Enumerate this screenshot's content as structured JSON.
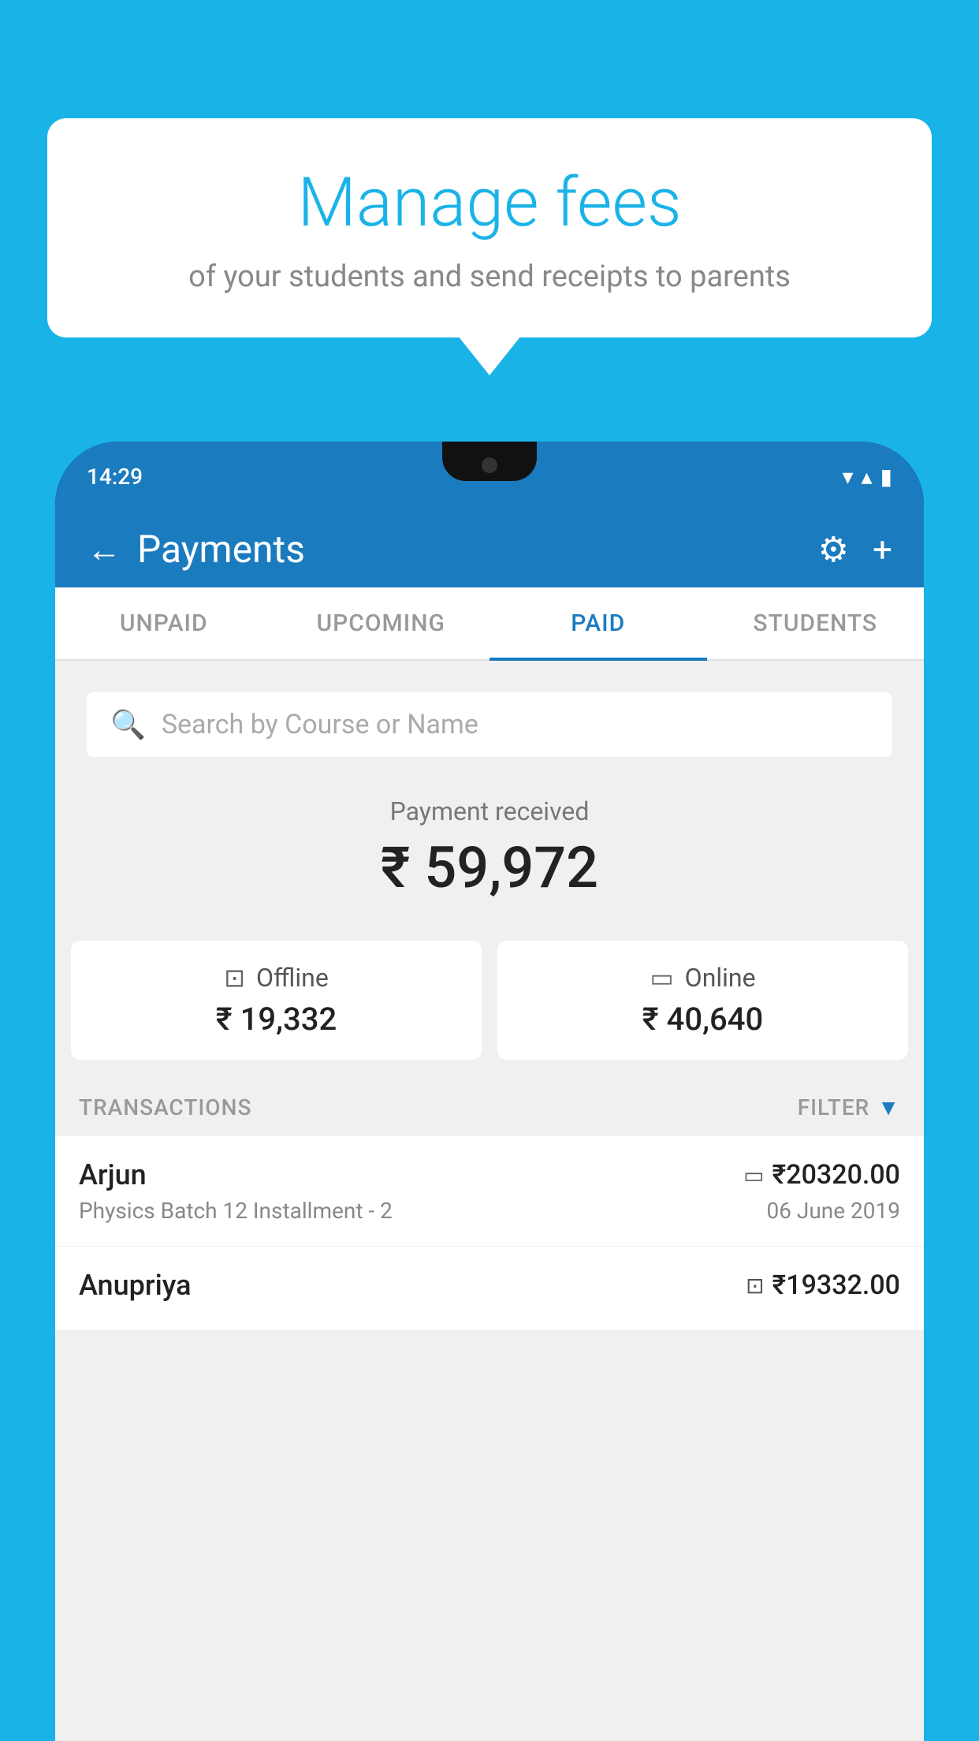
{
  "background": {
    "color": "#1ab3e8"
  },
  "speech_bubble": {
    "title": "Manage fees",
    "subtitle": "of your students and send receipts to parents"
  },
  "status_bar": {
    "time": "14:29",
    "wifi_icon": "▼",
    "signal_icon": "▲",
    "battery_icon": "▮"
  },
  "header": {
    "title": "Payments",
    "back_label": "←",
    "settings_label": "⚙",
    "add_label": "+"
  },
  "tabs": [
    {
      "label": "UNPAID",
      "active": false
    },
    {
      "label": "UPCOMING",
      "active": false
    },
    {
      "label": "PAID",
      "active": true
    },
    {
      "label": "STUDENTS",
      "active": false
    }
  ],
  "search": {
    "placeholder": "Search by Course or Name"
  },
  "payment_summary": {
    "label": "Payment received",
    "amount": "₹ 59,972",
    "offline": {
      "label": "Offline",
      "amount": "₹ 19,332"
    },
    "online": {
      "label": "Online",
      "amount": "₹ 40,640"
    }
  },
  "transactions": {
    "header_label": "TRANSACTIONS",
    "filter_label": "FILTER",
    "items": [
      {
        "name": "Arjun",
        "course": "Physics Batch 12 Installment - 2",
        "amount": "₹20320.00",
        "date": "06 June 2019",
        "icon": "card"
      },
      {
        "name": "Anupriya",
        "course": "",
        "amount": "₹19332.00",
        "date": "",
        "icon": "cash"
      }
    ]
  }
}
